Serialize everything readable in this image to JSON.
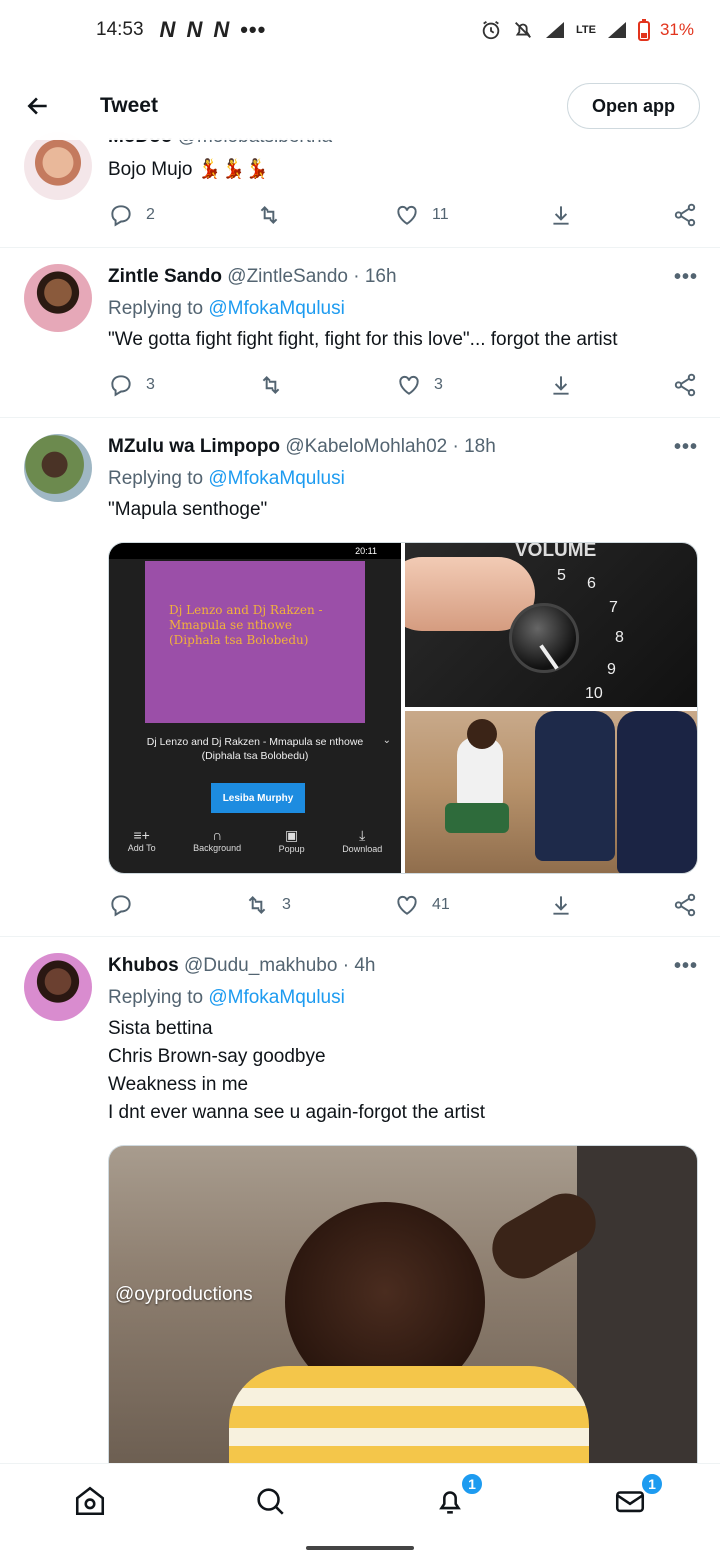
{
  "status_bar": {
    "time": "14:53",
    "network_icons": [
      "N",
      "N",
      "N"
    ],
    "more": "•••",
    "lte": "LTE",
    "battery": "31%"
  },
  "header": {
    "title": "Tweet",
    "open_app": "Open app"
  },
  "tweets": [
    {
      "name": "MoDoo",
      "handle": "@molobatsibertha",
      "text": "Bojo Mujo",
      "emoji": "💃💃💃",
      "replies": "2",
      "retweets": "",
      "likes": "11"
    },
    {
      "name": "Zintle Sando",
      "handle": "@ZintleSando · 16h",
      "replying_label": "Replying to",
      "mention": "@MfokaMqulusi",
      "text": "\"We gotta fight fight fight, fight for this love\"... forgot the artist",
      "replies": "3",
      "retweets": "",
      "likes": "3"
    },
    {
      "name": "MZulu wa Limpopo",
      "handle": "@KabeloMohlah02 · 18h",
      "replying_label": "Replying to",
      "mention": "@MfokaMqulusi",
      "text": "\"Mapula senthoge\"",
      "replies": "",
      "retweets": "3",
      "likes": "41",
      "media": {
        "phone_status": "20:11",
        "song_art_text": [
          "Dj Lenzo and Dj Rakzen -",
          "Mmapula se nthowe",
          "(Diphala tsa Bolobedu)"
        ],
        "song_title": [
          "Dj Lenzo and Dj Rakzen - Mmapula se nthowe",
          "(Diphala tsa Bolobedu)"
        ],
        "artist_button": "Lesiba Murphy",
        "controls": [
          "Add To",
          "Background",
          "Popup",
          "Download"
        ],
        "volume_label": "VOLUME",
        "volume_numbers": [
          "5",
          "6",
          "7",
          "8",
          "9",
          "10"
        ]
      }
    },
    {
      "name": "Khubos",
      "handle": "@Dudu_makhubo · 4h",
      "replying_label": "Replying to",
      "mention": "@MfokaMqulusi",
      "lines": [
        "Sista bettina",
        "Chris Brown-say goodbye",
        "Weakness in me",
        "I dnt ever wanna see u again-forgot the artist"
      ],
      "media_watermark": "@oyproductions"
    }
  ],
  "bottom_nav": {
    "notifications_badge": "1",
    "messages_badge": "1"
  },
  "colors": {
    "accent": "#1d9bf0",
    "secondary_text": "#536471",
    "divider": "#eff3f4"
  }
}
